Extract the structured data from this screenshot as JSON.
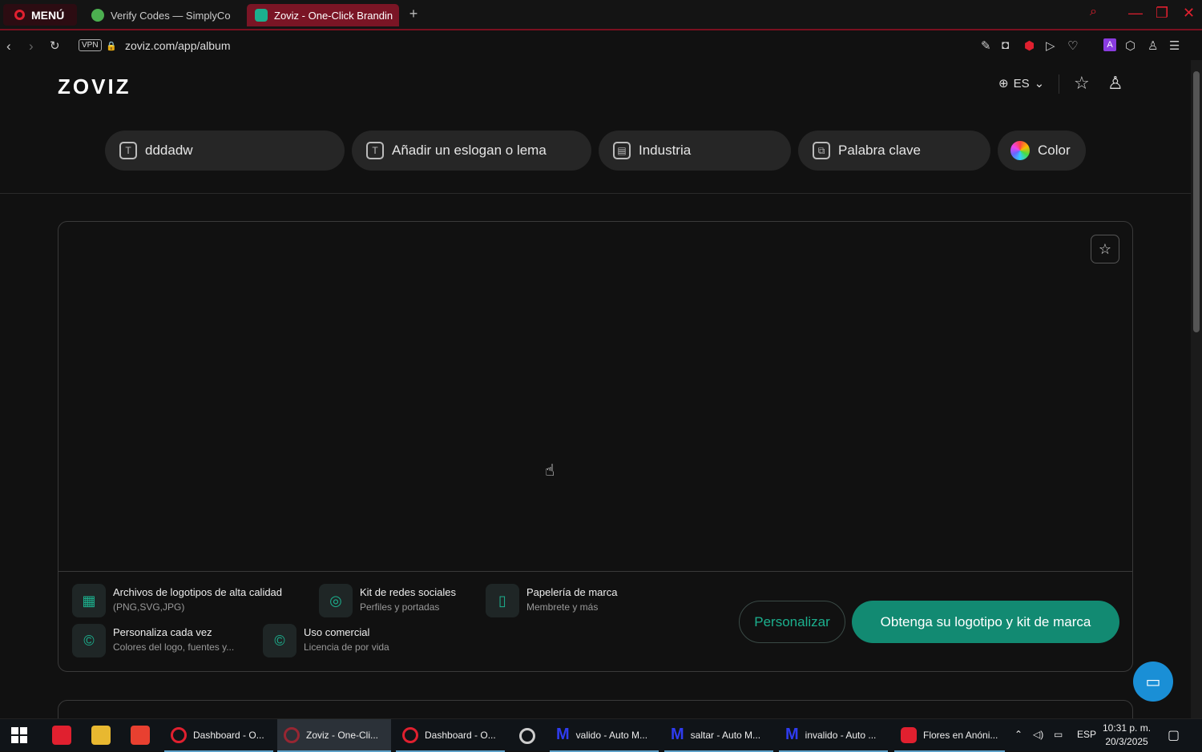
{
  "browser": {
    "menu_label": "MENÚ",
    "tabs": [
      {
        "title": "Verify Codes — SimplyCo"
      },
      {
        "title": "Zoviz - One-Click Brandin"
      }
    ],
    "vpn_label": "VPN",
    "url": "zoviz.com/app/album"
  },
  "site": {
    "logo": "ZOVIZ",
    "language": "ES"
  },
  "filters": [
    {
      "label": "dddadw",
      "icon": "text-icon"
    },
    {
      "label": "Añadir un eslogan o lema",
      "icon": "text-plus-icon"
    },
    {
      "label": "Industria",
      "icon": "briefcase-icon"
    },
    {
      "label": "Palabra clave",
      "icon": "keyword-icon"
    },
    {
      "label": "Color",
      "icon": "color-wheel-icon"
    }
  ],
  "features": [
    {
      "title": "Archivos de logotipos de alta calidad",
      "subtitle": "(PNG,SVG,JPG)",
      "icon": "grid-icon"
    },
    {
      "title": "Kit de redes sociales",
      "subtitle": "Perfiles y portadas",
      "icon": "instagram-icon"
    },
    {
      "title": "Papelería de marca",
      "subtitle": "Membrete y más",
      "icon": "document-icon"
    },
    {
      "title": "Personaliza cada vez",
      "subtitle": "Colores del logo, fuentes y...",
      "icon": "copyright-icon"
    },
    {
      "title": "Uso comercial",
      "subtitle": "Licencia de por vida",
      "icon": "copyright-icon"
    }
  ],
  "actions": {
    "customize": "Personalizar",
    "get_logo": "Obtenga su logotipo y kit de marca"
  },
  "taskbar": {
    "items": [
      {
        "label": "Dashboard - O..."
      },
      {
        "label": "Zoviz - One-Cli..."
      },
      {
        "label": "Dashboard - O..."
      },
      {
        "label": "valido - Auto M..."
      },
      {
        "label": "saltar - Auto M..."
      },
      {
        "label": "invalido - Auto ..."
      },
      {
        "label": "Flores en Anóni..."
      }
    ],
    "language": "ESP",
    "time": "10:31 p. m.",
    "date": "20/3/2025"
  },
  "colors": {
    "accent": "#1cb08e",
    "primary_button": "#128a72",
    "opera_red": "#e0202f"
  }
}
